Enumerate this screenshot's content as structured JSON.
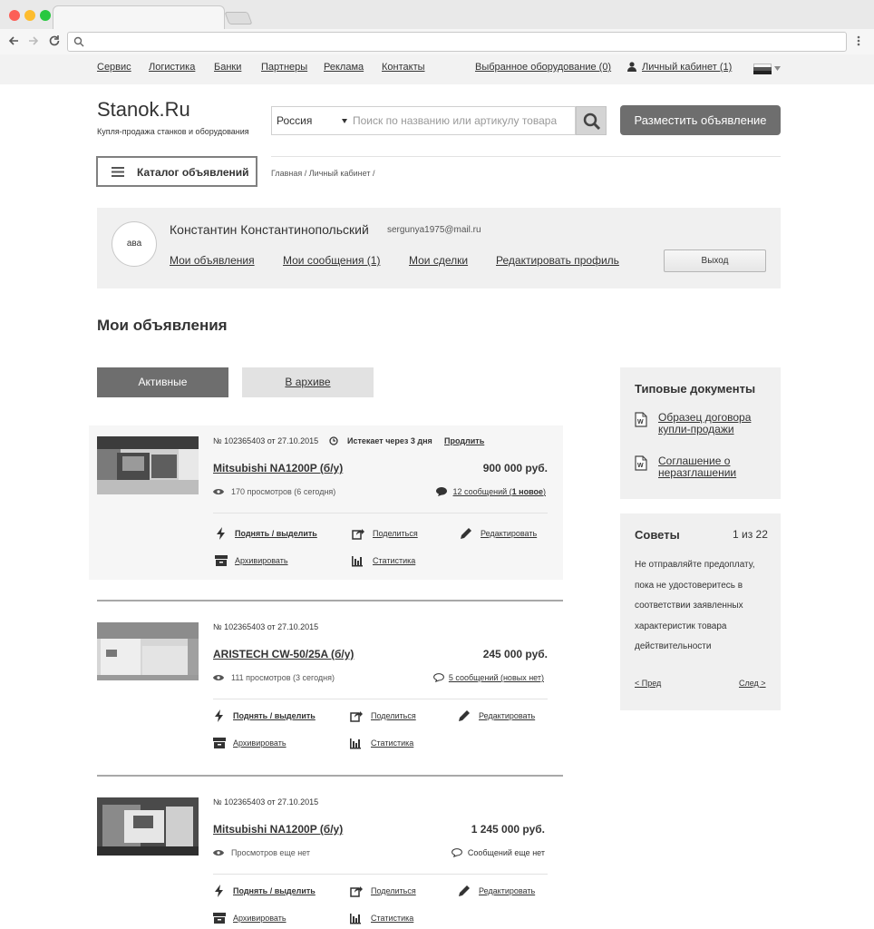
{
  "topnav": {
    "items": [
      "Сервис",
      "Логистика",
      "Банки",
      "Партнеры",
      "Реклама",
      "Контакты"
    ],
    "favorites": "Выбранное оборудование (0)",
    "cabinet": "Личный кабинет (1)"
  },
  "header": {
    "logo": "Stanok.Ru",
    "tagline": "Купля-продажа станков и оборудования",
    "region": "Россия",
    "search_placeholder": "Поиск по названию или артикулу товара",
    "post_ad": "Разместить объявление",
    "catalog": "Каталог объявлений",
    "breadcrumb": "Главная / Личный кабинет /"
  },
  "profile": {
    "avatar": "ава",
    "name": "Константин Константинопольский",
    "email": "sergunya1975@mail.ru",
    "links": [
      "Мои объявления",
      "Мои сообщения (1)",
      "Мои сделки",
      "Редактировать профиль"
    ],
    "logout": "Выход"
  },
  "page": {
    "title": "Мои объявления",
    "tab_active": "Активные",
    "tab_archive": "В архиве"
  },
  "actions": {
    "raise": "Поднять / выделить",
    "share": "Поделиться",
    "edit": "Редактировать",
    "archive": "Архивировать",
    "stats": "Статистика"
  },
  "listings": [
    {
      "meta": "№ 102365403 от 27.10.2015",
      "expires": "Истекает через 3 дня",
      "prolong": "Продлить",
      "title": "Mitsubishi NA1200P (б/у)",
      "price": "900 000 руб.",
      "views": "170 просмотров (6 сегодня)",
      "messages_prefix": "12 сообщений (",
      "messages_new": "1 новое",
      "messages_suffix": ")"
    },
    {
      "meta": "№ 102365403 от 27.10.2015",
      "title": "ARISTECH CW-50/25A (б/у)",
      "price": "245 000 руб.",
      "views": "111 просмотров (3 сегодня)",
      "messages": "5 сообщений (новых нет)"
    },
    {
      "meta": "№ 102365403 от 27.10.2015",
      "title": "Mitsubishi NA1200P (б/у)",
      "price": "1 245 000 руб.",
      "views": "Просмотров еще нет",
      "messages": "Сообщений еще нет"
    }
  ],
  "sidebar": {
    "docs_title": "Типовые документы",
    "doc1": "Образец договора купли-продажи",
    "doc2": "Соглашение о неразглашении",
    "tips_title": "Советы",
    "tips_counter": "1 из 22",
    "tip_text": "Не отправляйте предоплату, пока не удостоверитесь в соответствии заявленных характеристик товара действительности",
    "prev": "< Пред",
    "next": "След >"
  }
}
